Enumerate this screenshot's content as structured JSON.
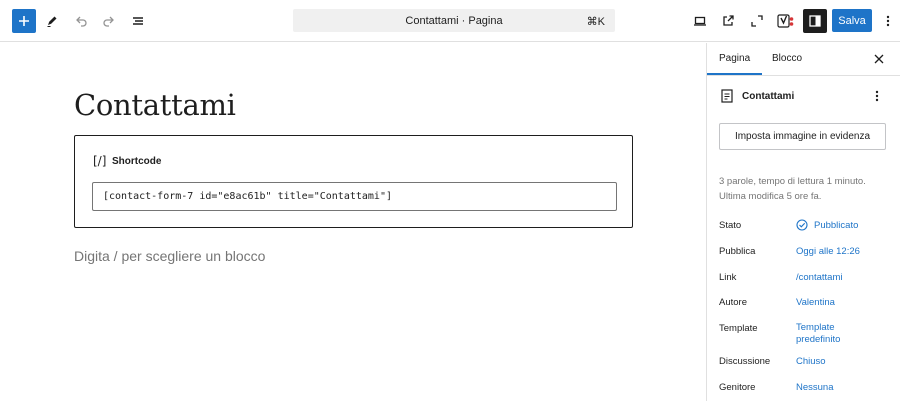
{
  "header": {
    "document_title": "Contattami · Pagina",
    "shortcut": "⌘K",
    "save_label": "Salva"
  },
  "editor": {
    "title": "Contattami",
    "shortcode_label": "Shortcode",
    "shortcode_value": "[contact-form-7 id=\"e8ac61b\" title=\"Contattami\"]",
    "placeholder": "Digita / per scegliere un blocco"
  },
  "sidebar": {
    "tabs": [
      {
        "label": "Pagina",
        "active": true
      },
      {
        "label": "Blocco",
        "active": false
      }
    ],
    "document_name": "Contattami",
    "featured_image_button": "Imposta immagine in evidenza",
    "stats": "3 parole, tempo di lettura 1 minuto.",
    "last_modified": "Ultima modifica 5 ore fa.",
    "fields": [
      {
        "label": "Stato",
        "value": "Pubblicato"
      },
      {
        "label": "Pubblica",
        "value": "Oggi alle 12:26"
      },
      {
        "label": "Link",
        "value": "/contattami"
      },
      {
        "label": "Autore",
        "value": "Valentina"
      },
      {
        "label": "Template",
        "value": "Template predefinito"
      },
      {
        "label": "Discussione",
        "value": "Chiuso"
      },
      {
        "label": "Genitore",
        "value": "Nessuna"
      }
    ]
  },
  "colors": {
    "accent": "#1e74c8",
    "dark": "#1e1e1e",
    "muted": "#757575"
  },
  "icons": [
    "plus-icon",
    "pencil-icon",
    "undo-icon",
    "redo-icon",
    "list-view-icon",
    "desktop-preview-icon",
    "external-link-icon",
    "fullscreen-icon",
    "yoast-icon",
    "sidebar-settings-icon",
    "more-vertical-icon",
    "close-icon",
    "page-icon",
    "shortcode-icon",
    "published-status-icon"
  ]
}
